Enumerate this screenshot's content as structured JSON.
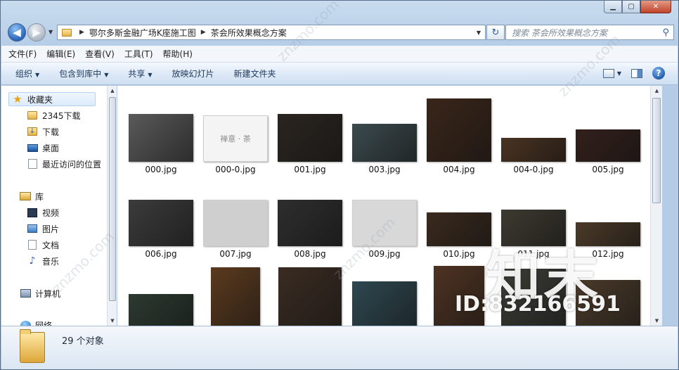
{
  "nav": {
    "breadcrumbs": [
      "鄂尔多斯金融广场K座施工图",
      "茶会所效果概念方案"
    ],
    "search_placeholder": "搜索 茶会所效果概念方案"
  },
  "menu": [
    "文件(F)",
    "编辑(E)",
    "查看(V)",
    "工具(T)",
    "帮助(H)"
  ],
  "commands": {
    "organize": "组织",
    "include_library": "包含到库中",
    "share": "共享",
    "slideshow": "放映幻灯片",
    "new_folder": "新建文件夹"
  },
  "sidebar": {
    "favorites_label": "收藏夹",
    "favorites": [
      "2345下载",
      "下载",
      "桌面",
      "最近访问的位置"
    ],
    "library_label": "库",
    "libraries": [
      "视频",
      "图片",
      "文档",
      "音乐"
    ],
    "computer_label": "计算机",
    "network_label": "网络"
  },
  "files": [
    {
      "name": "000.jpg",
      "tone": "#5a5a5a"
    },
    {
      "name": "000-0.jpg",
      "tone": "#f4f4f4",
      "caption": "禅意 · 茶"
    },
    {
      "name": "001.jpg",
      "tone": "#2b2520"
    },
    {
      "name": "003.jpg",
      "tone": "#3b4a4e"
    },
    {
      "name": "004.jpg",
      "tone": "#3a261a"
    },
    {
      "name": "004-0.jpg",
      "tone": "#4a3322"
    },
    {
      "name": "005.jpg",
      "tone": "#33201c"
    },
    {
      "name": "006.jpg",
      "tone": "#3b3b3b"
    },
    {
      "name": "007.jpg",
      "tone": "#cfcfcf"
    },
    {
      "name": "008.jpg",
      "tone": "#2e2e2e"
    },
    {
      "name": "009.jpg",
      "tone": "#d8d8d8"
    },
    {
      "name": "010.jpg",
      "tone": "#3a2a1e"
    },
    {
      "name": "011.jpg",
      "tone": "#3d3a30"
    },
    {
      "name": "012.jpg",
      "tone": "#4b3a28"
    },
    {
      "name": "",
      "tone": "#2c3a30"
    },
    {
      "name": "",
      "tone": "#5b3a1e"
    },
    {
      "name": "",
      "tone": "#3a2c22"
    },
    {
      "name": "",
      "tone": "#2e4850"
    },
    {
      "name": "",
      "tone": "#4e3322"
    },
    {
      "name": "",
      "tone": "#3c3c36"
    },
    {
      "name": "",
      "tone": "#4a3a2a"
    }
  ],
  "status": {
    "count_text": "29 个对象"
  },
  "watermark": {
    "brand": "知末",
    "id": "ID:832166591",
    "site": "znzmo.com"
  }
}
